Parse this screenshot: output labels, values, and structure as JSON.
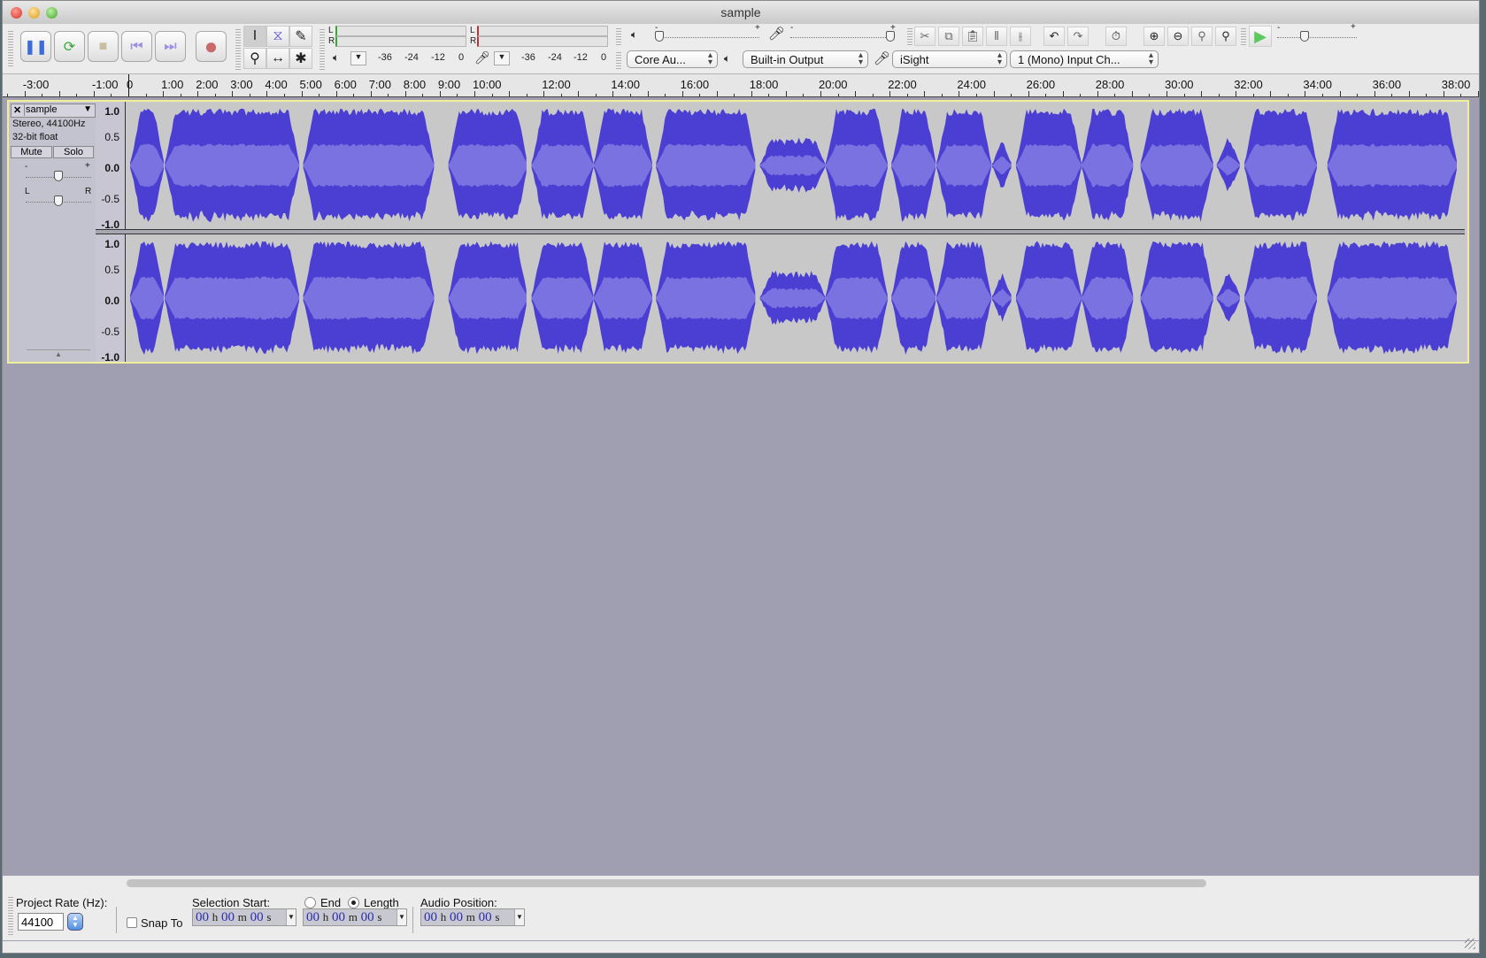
{
  "window": {
    "title": "sample"
  },
  "transport": {
    "buttons": [
      {
        "name": "pause-button",
        "icon": "pause-icon",
        "glyph": "❚❚",
        "color": "#3b6cd9"
      },
      {
        "name": "play-button",
        "icon": "loop-play-icon",
        "glyph": "⟳",
        "color": "#3aa53a"
      },
      {
        "name": "stop-button",
        "icon": "stop-icon",
        "glyph": "■",
        "color": "#c8bda0"
      },
      {
        "name": "skip-to-start-button",
        "icon": "skip-start-icon",
        "glyph": "⏮",
        "color": "#9f8fe0"
      },
      {
        "name": "skip-to-end-button",
        "icon": "skip-end-icon",
        "glyph": "⏭",
        "color": "#9f8fe0"
      },
      {
        "name": "record-button",
        "icon": "record-icon",
        "glyph": "●",
        "color": "#c96a6a"
      }
    ]
  },
  "tools": [
    {
      "name": "selection-tool",
      "glyph": "I",
      "selected": true
    },
    {
      "name": "envelope-tool",
      "glyph": "⧖",
      "selected": false
    },
    {
      "name": "draw-tool",
      "glyph": "✎",
      "selected": false
    },
    {
      "name": "zoom-tool",
      "glyph": "⚲",
      "selected": false
    },
    {
      "name": "time-shift-tool",
      "glyph": "↔",
      "selected": false
    },
    {
      "name": "multi-tool",
      "glyph": "✱",
      "selected": false
    }
  ],
  "meters": {
    "playback": {
      "channels": [
        "L",
        "R"
      ],
      "scale": [
        "-36",
        "-24",
        "-12",
        "0"
      ]
    },
    "record": {
      "channels": [
        "L",
        "R"
      ],
      "scale": [
        "-36",
        "-24",
        "-12",
        "0"
      ]
    }
  },
  "mixer": {
    "output_volume_fraction": 0.0,
    "input_volume_fraction": 1.0,
    "minus": "-",
    "plus": "+"
  },
  "devices": {
    "host": "Core Au...",
    "output": "Built-in Output",
    "input": "iSight",
    "input_channels": "1 (Mono) Input Ch..."
  },
  "edit": {
    "buttons": [
      "cut",
      "copy",
      "paste",
      "trim",
      "silence",
      "undo",
      "redo",
      "sync-lock",
      "zoom-in",
      "zoom-out",
      "fit-selection",
      "fit-project"
    ]
  },
  "play_at_speed": {
    "speed_fraction": 0.33,
    "minus": "-",
    "plus": "+"
  },
  "ruler": {
    "ticks": [
      "-3:00",
      "-1:00",
      "0",
      "1:00",
      "2:00",
      "3:00",
      "4:00",
      "5:00",
      "6:00",
      "7:00",
      "8:00",
      "9:00",
      "10:00",
      "12:00",
      "14:00",
      "16:00",
      "18:00",
      "20:00",
      "22:00",
      "24:00",
      "26:00",
      "28:00",
      "30:00",
      "32:00",
      "34:00",
      "36:00",
      "38:00"
    ],
    "tick_minutes": [
      -3,
      -1,
      0,
      1,
      2,
      3,
      4,
      5,
      6,
      7,
      8,
      9,
      10,
      12,
      14,
      16,
      18,
      20,
      22,
      24,
      26,
      28,
      30,
      32,
      34,
      36,
      38
    ]
  },
  "track": {
    "name": "sample",
    "format": "Stereo, 44100Hz",
    "bit_depth": "32-bit float",
    "mute_label": "Mute",
    "solo_label": "Solo",
    "gain_minus": "-",
    "gain_plus": "+",
    "pan_left": "L",
    "pan_right": "R",
    "gain_fraction": 0.5,
    "pan_fraction": 0.5,
    "amplitude_labels": [
      "1.0",
      "0.5",
      "0.0",
      "-0.5",
      "-1.0"
    ],
    "wave_color": "#4b3fd3",
    "rms_color": "#7a72e0",
    "segments_minutes": [
      [
        0,
        1.0
      ],
      [
        1.0,
        4.9
      ],
      [
        5.0,
        8.8
      ],
      [
        9.2,
        11.5
      ],
      [
        11.6,
        13.4
      ],
      [
        13.4,
        15.1
      ],
      [
        15.2,
        18.1
      ],
      [
        18.2,
        20.1
      ],
      [
        20.1,
        21.9
      ],
      [
        22.0,
        23.3
      ],
      [
        23.3,
        24.9
      ],
      [
        24.9,
        25.5
      ],
      [
        25.6,
        27.5
      ],
      [
        27.5,
        29.0
      ],
      [
        29.2,
        31.3
      ],
      [
        31.4,
        32.1
      ],
      [
        32.2,
        34.3
      ],
      [
        34.6,
        38.6
      ]
    ]
  },
  "statusbar": {
    "project_rate_label": "Project Rate (Hz):",
    "project_rate_value": "44100",
    "snap_to_label": "Snap To",
    "snap_to_checked": false,
    "selection_start_label": "Selection Start:",
    "end_label": "End",
    "length_label": "Length",
    "length_selected": true,
    "audio_position_label": "Audio Position:",
    "time_parts": {
      "h": "00",
      "m": "00",
      "s": "00",
      "hu": "h",
      "mu": "m",
      "su": "s"
    }
  }
}
